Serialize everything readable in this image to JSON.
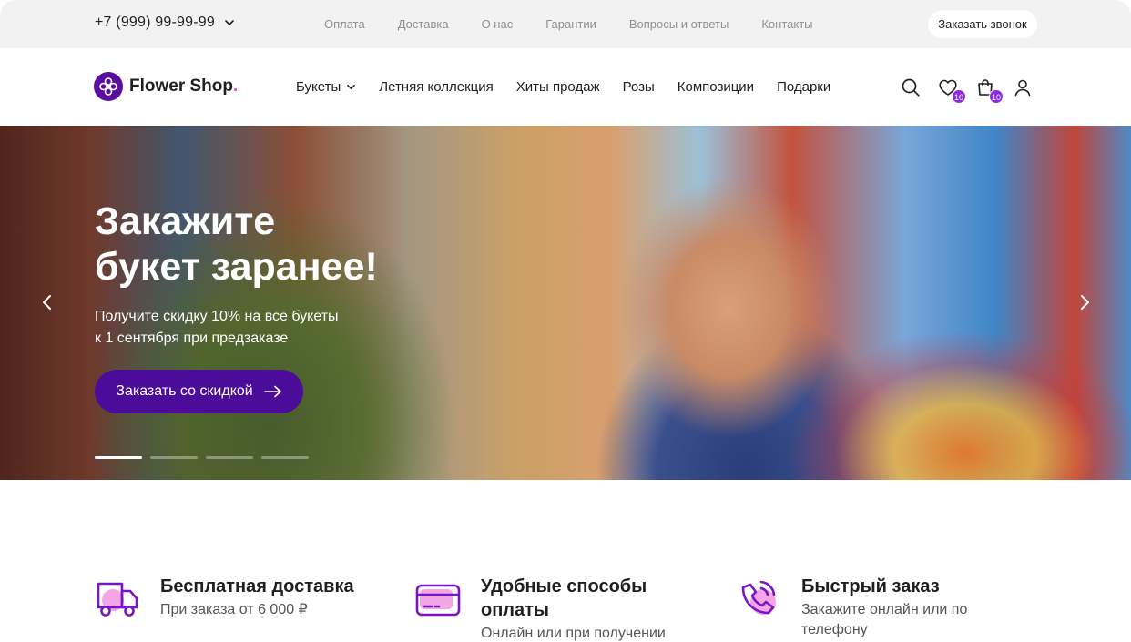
{
  "topbar": {
    "phone": "+7 (999) 99-99-99",
    "links": [
      "Оплата",
      "Доставка",
      "О нас",
      "Гарантии",
      "Вопросы и ответы",
      "Контакты"
    ],
    "call_button": "Заказать звонок"
  },
  "header": {
    "logo_name": "Flower Shop",
    "logo_dot": ".",
    "nav": [
      "Букеты",
      "Летняя коллекция",
      "Хиты продаж",
      "Розы",
      "Композиции",
      "Подарки"
    ],
    "favorites_count": "10",
    "cart_count": "10"
  },
  "hero": {
    "title": "Закажите\nбукет заранее!",
    "subtitle": "Получите скидку 10% на все букеты\nк 1 сентября при предзаказе",
    "cta": "Заказать со скидкой",
    "slides_total": 4,
    "active_slide": 1
  },
  "features": [
    {
      "title": "Бесплатная доставка",
      "subtitle": "При заказа от 6 000 ₽",
      "icon": "truck-icon"
    },
    {
      "title": "Удобные способы\nоплаты",
      "subtitle": "Онлайн или при получении",
      "icon": "card-icon"
    },
    {
      "title": "Быстрый заказ",
      "subtitle": "Закажите онлайн или по\nтелефону",
      "icon": "phone-icon"
    }
  ],
  "colors": {
    "accent": "#4b0c9a",
    "badge": "#8a2be2",
    "pink": "#e34fc4"
  }
}
